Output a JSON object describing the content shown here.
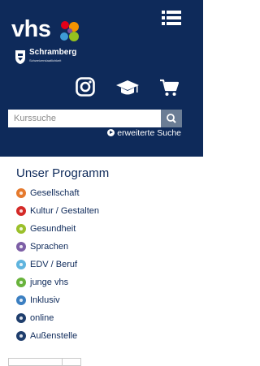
{
  "header": {
    "logo_text": "vhs",
    "town_name": "Schramberg",
    "town_subtitle": "Schweizerstaatlichkeit",
    "dot_colors": [
      "#e2001a",
      "#f39200",
      "#3e9bd5",
      "#95c11f",
      "#7d4e9f"
    ]
  },
  "search": {
    "placeholder": "Kurssuche",
    "advanced_label": "erweiterte Suche"
  },
  "program": {
    "title": "Unser Programm",
    "items": [
      {
        "label": "Gesellschaft",
        "color": "#e57a2e",
        "icon": "society-icon"
      },
      {
        "label": "Kultur / Gestalten",
        "color": "#d42a28",
        "icon": "culture-icon"
      },
      {
        "label": "Gesundheit",
        "color": "#9bc02b",
        "icon": "health-icon"
      },
      {
        "label": "Sprachen",
        "color": "#7d5fa6",
        "icon": "languages-icon"
      },
      {
        "label": "EDV / Beruf",
        "color": "#5fb4de",
        "icon": "computer-icon"
      },
      {
        "label": "junge vhs",
        "color": "#69b33c",
        "icon": "youth-icon"
      },
      {
        "label": "Inklusiv",
        "color": "#3c7fc1",
        "icon": "inclusive-icon"
      },
      {
        "label": "online",
        "color": "#1f3e6d",
        "icon": "online-icon"
      },
      {
        "label": "Außenstelle",
        "color": "#1f3e6d",
        "icon": "branch-icon"
      }
    ]
  }
}
